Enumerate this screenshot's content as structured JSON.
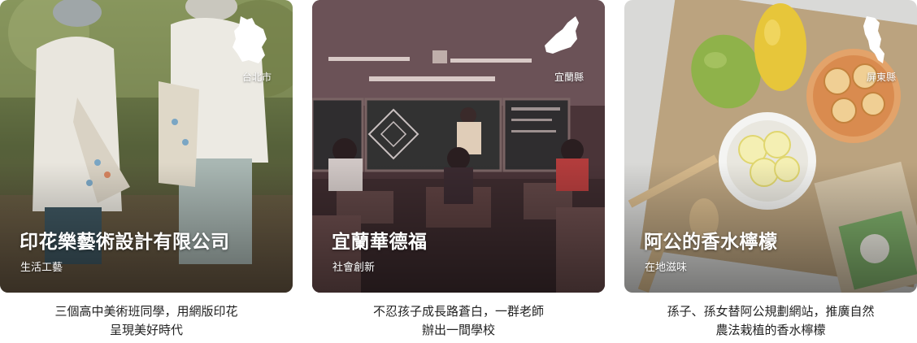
{
  "cards": [
    {
      "title": "印花樂藝術設計有限公司",
      "category": "生活工藝",
      "region": "台北市",
      "region_icon": "taipei-map-icon",
      "description_lines": [
        "三個高中美術班同學，用網版印花",
        "呈現美好時代"
      ]
    },
    {
      "title": "宜蘭華德福",
      "category": "社會創新",
      "region": "宜蘭縣",
      "region_icon": "yilan-map-icon",
      "description_lines": [
        "不忍孩子成長路蒼白，一群老師",
        "辦出一間學校"
      ]
    },
    {
      "title": "阿公的香水檸檬",
      "category": "在地滋味",
      "region": "屏東縣",
      "region_icon": "pingtung-map-icon",
      "description_lines": [
        "孫子、孫女替阿公規劃網站，推廣自然",
        "農法栽植的香水檸檬"
      ]
    }
  ]
}
